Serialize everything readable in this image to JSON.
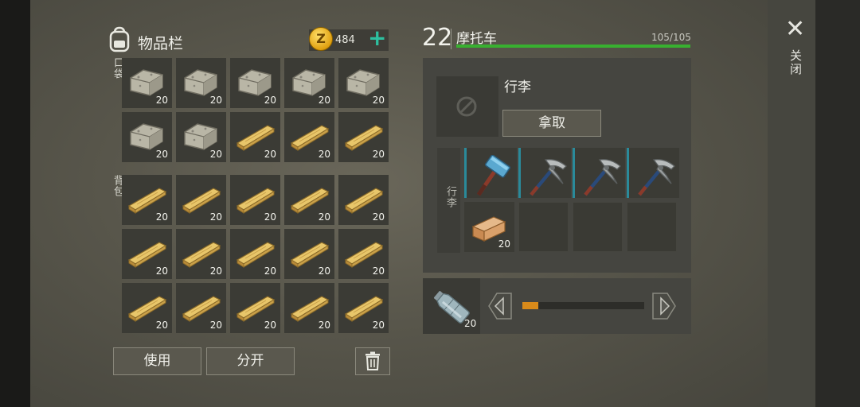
{
  "inventory": {
    "title": "物品栏",
    "coins": "484",
    "coin_symbol": "Z",
    "add_symbol": "+",
    "pocket_label": "口袋",
    "backpack_label": "背包",
    "pocket_slots": [
      {
        "item": "stone",
        "count": "20"
      },
      {
        "item": "stone",
        "count": "20"
      },
      {
        "item": "stone",
        "count": "20"
      },
      {
        "item": "stone",
        "count": "20"
      },
      {
        "item": "stone",
        "count": "20"
      },
      {
        "item": "stone",
        "count": "20"
      },
      {
        "item": "stone",
        "count": "20"
      },
      {
        "item": "plank",
        "count": "20"
      },
      {
        "item": "plank",
        "count": "20"
      },
      {
        "item": "plank",
        "count": "20"
      }
    ],
    "backpack_slots": [
      {
        "item": "plank",
        "count": "20"
      },
      {
        "item": "plank",
        "count": "20"
      },
      {
        "item": "plank",
        "count": "20"
      },
      {
        "item": "plank",
        "count": "20"
      },
      {
        "item": "plank",
        "count": "20"
      },
      {
        "item": "plank",
        "count": "20"
      },
      {
        "item": "plank",
        "count": "20"
      },
      {
        "item": "plank",
        "count": "20"
      },
      {
        "item": "plank",
        "count": "20"
      },
      {
        "item": "plank",
        "count": "20"
      },
      {
        "item": "plank",
        "count": "20"
      },
      {
        "item": "plank",
        "count": "20"
      },
      {
        "item": "plank",
        "count": "20"
      },
      {
        "item": "plank",
        "count": "20"
      },
      {
        "item": "plank",
        "count": "20"
      }
    ],
    "use_label": "使用",
    "split_label": "分开",
    "trash_icon": "trash-icon"
  },
  "vehicle": {
    "level": "22",
    "name": "摩托车",
    "durability": "105/105",
    "durability_fraction": 1.0,
    "cargo_title": "行李",
    "take_label": "拿取",
    "cargo_side_label": "行李",
    "cargo_slots": [
      {
        "item": "sledgehammer",
        "count": ""
      },
      {
        "item": "pickaxe",
        "count": ""
      },
      {
        "item": "pickaxe",
        "count": ""
      },
      {
        "item": "pickaxe",
        "count": ""
      },
      {
        "item": "wood-log",
        "count": "20"
      },
      {
        "item": "empty",
        "count": ""
      },
      {
        "item": "empty",
        "count": ""
      },
      {
        "item": "empty",
        "count": ""
      }
    ],
    "fuel_item": "water-bottle",
    "fuel_count": "20",
    "fuel_fraction": 0.13
  },
  "close_label": "关闭",
  "colors": {
    "durability_green": "#38b030",
    "fuel_orange": "#d88a1a",
    "plus_teal": "#2dc0a0"
  }
}
